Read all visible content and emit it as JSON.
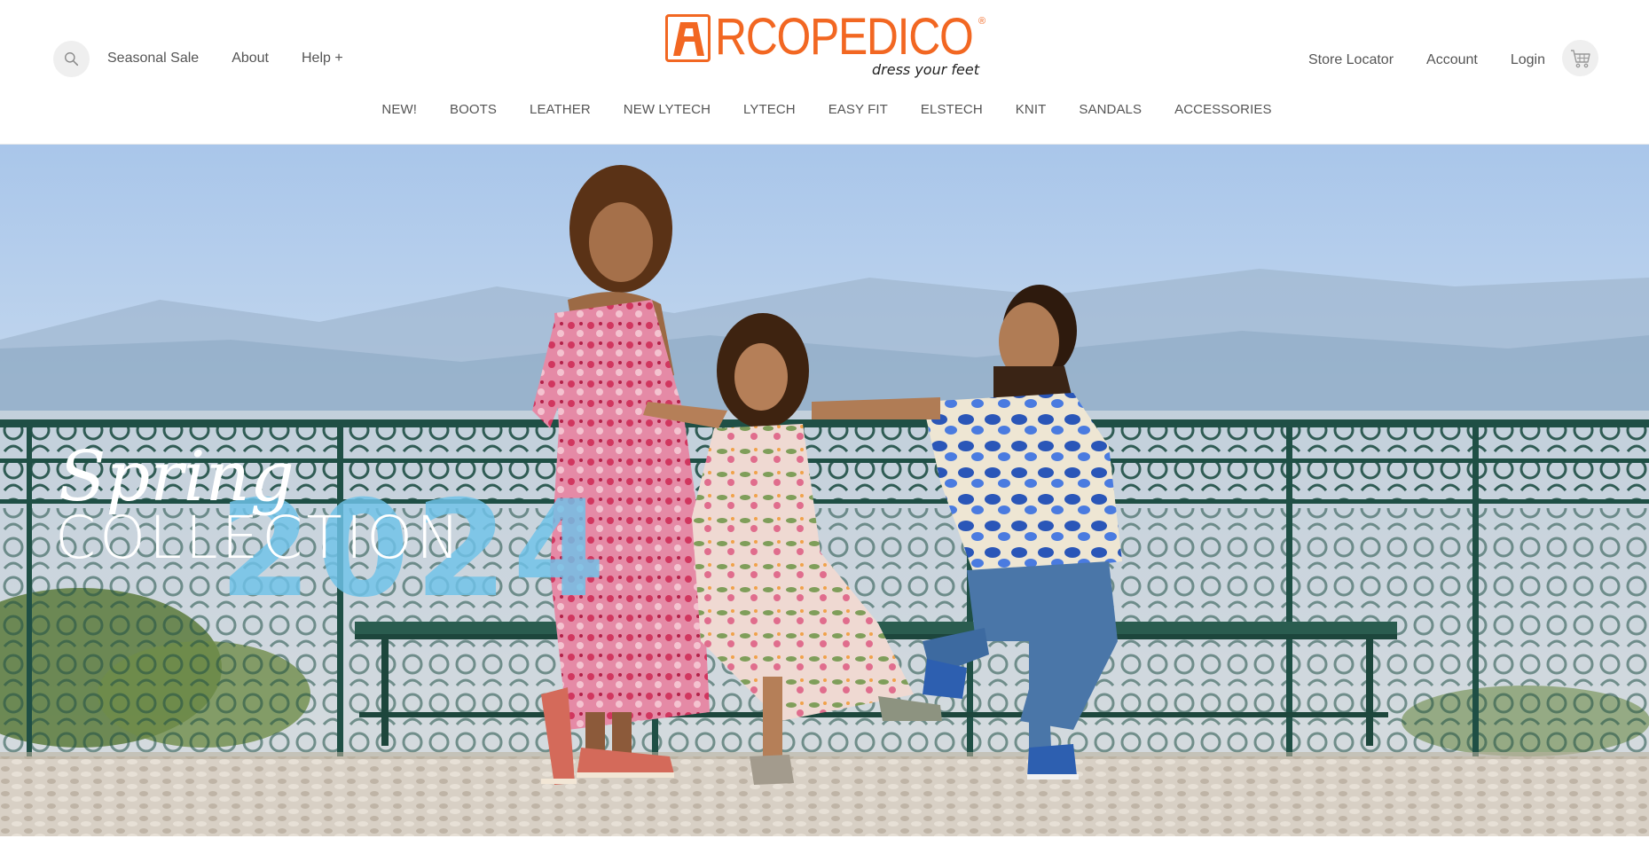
{
  "brand": {
    "name": "RCOPEDICO",
    "tagline": "dress your feet",
    "registered_mark": "®",
    "color": "#f26722"
  },
  "header": {
    "search_icon": "search-icon",
    "utility_left": [
      "Seasonal Sale",
      "About",
      "Help +"
    ],
    "utility_right": [
      "Store Locator",
      "Account",
      "Login"
    ],
    "cart_icon": "cart-icon"
  },
  "categories": [
    "NEW!",
    "BOOTS",
    "LEATHER",
    "NEW LYTECH",
    "LYTECH",
    "EASY FIT",
    "ELSTECH",
    "KNIT",
    "SANDALS",
    "ACCESSORIES"
  ],
  "hero": {
    "line1": "Spring",
    "line2": "COLLECTION",
    "year": "2024",
    "year_color": "#6fc3ea"
  }
}
